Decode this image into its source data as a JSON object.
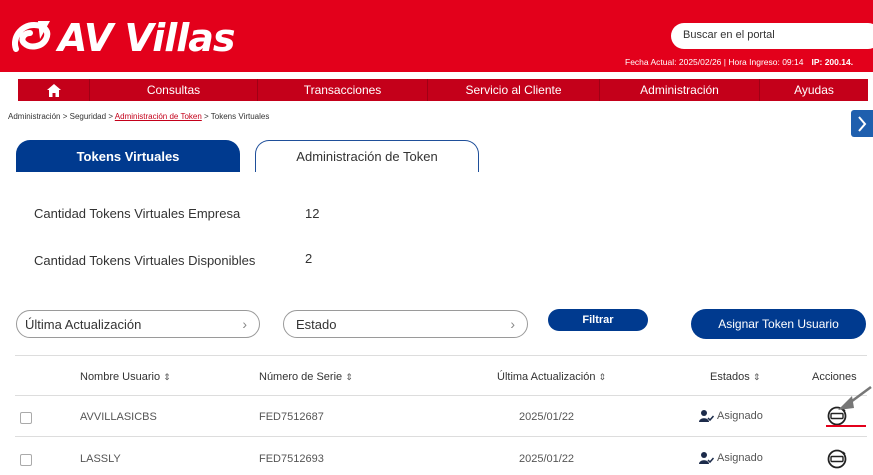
{
  "header": {
    "brand": "AV Villas",
    "search_placeholder": "Buscar en el portal",
    "date_text": "Fecha Actual: 2025/02/26 | Hora Ingreso: 09:14",
    "ip_text": "IP: 200.14.",
    "brand_color": "#e3001b"
  },
  "menu": {
    "home_icon": "home-icon",
    "items": [
      "Consultas",
      "Transacciones",
      "Servicio al Cliente",
      "Administración",
      "Ayudas"
    ]
  },
  "breadcrumb": {
    "items": [
      "Administración",
      "Seguridad",
      "Administración de Token",
      "Tokens Virtuales"
    ],
    "separator": ">"
  },
  "tabs": [
    "Tokens Virtuales",
    "Administración de Token"
  ],
  "stats": {
    "empresa_label": "Cantidad Tokens Virtuales Empresa",
    "empresa_value": "12",
    "disponibles_label": "Cantidad Tokens Virtuales Disponibles",
    "disponibles_value": "2"
  },
  "filters": {
    "last_update": "Última Actualización",
    "estado": "Estado",
    "filter_button": "Filtrar",
    "assign_button": "Asignar Token Usuario"
  },
  "table": {
    "headers": [
      "Nombre Usuario",
      "Número de Serie",
      "Última Actualización",
      "Estados",
      "Acciones"
    ],
    "rows": [
      {
        "user": "AVVILLASICBS",
        "serial": "FED7512687",
        "updated": "2025/01/22",
        "status": "Asignado"
      },
      {
        "user": "LASSLY",
        "serial": "FED7512693",
        "updated": "2025/01/22",
        "status": "Asignado"
      }
    ]
  },
  "colors": {
    "primary_blue": "#003a8f",
    "menu_red": "#c4001a"
  }
}
